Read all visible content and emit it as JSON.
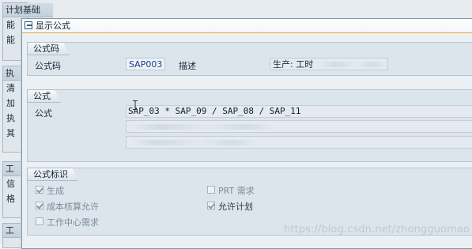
{
  "background": {
    "group_title": "计划基础",
    "row_glyphs": [
      "能",
      "能"
    ],
    "section2_glyphs": [
      "执",
      "清",
      "加",
      "执",
      "其"
    ],
    "section3_glyphs": [
      "工",
      "信",
      "格"
    ],
    "section4_glyphs": [
      "工"
    ]
  },
  "dialog": {
    "title": "显示公式",
    "formula_key_group": {
      "title": "公式码",
      "key_label": "公式码",
      "key_value": "SAP003",
      "desc_label": "描述",
      "desc_value": "生产: 工时"
    },
    "formula_group": {
      "title": "公式",
      "label": "公式",
      "formula": "SAP_03 * SAP_09 / SAP_08 / SAP_11"
    },
    "flags_group": {
      "title": "公式标识",
      "items": [
        {
          "label": "生成",
          "checked": true,
          "enabled": false
        },
        {
          "label": "PRT 需求",
          "checked": false,
          "enabled": false
        },
        {
          "label": "成本核算允许",
          "checked": true,
          "enabled": false
        },
        {
          "label": "允许计划",
          "checked": true,
          "enabled": true
        },
        {
          "label": "工作中心需求",
          "checked": false,
          "enabled": false
        }
      ]
    }
  },
  "watermark": "https://blog.csdn.net/zhongguomao",
  "colors": {
    "accent_line": "#f2a637",
    "key_text": "#1a3d8f",
    "dialog_bg": "#eaf0f4"
  }
}
